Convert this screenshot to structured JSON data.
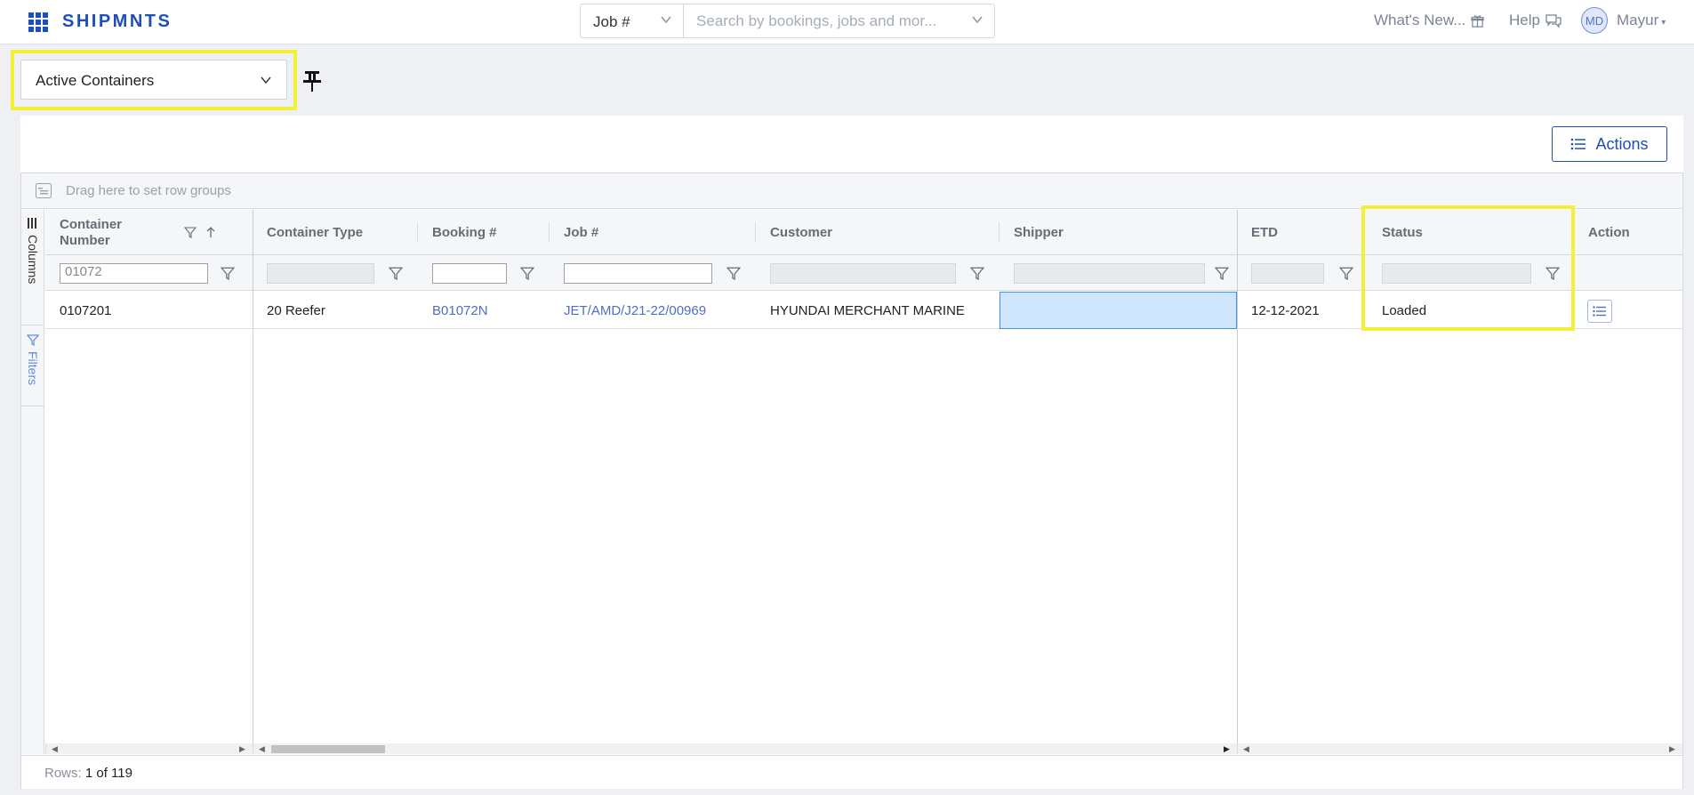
{
  "app": {
    "logo": "SHIPMNTS",
    "search_type": "Job #",
    "search_placeholder": "Search by bookings, jobs and mor...",
    "whats_new": "What's New...",
    "help": "Help",
    "user_initials": "MD",
    "user_name": "Mayur"
  },
  "view": {
    "selected": "Active Containers"
  },
  "toolbar": {
    "actions_label": "Actions"
  },
  "grid": {
    "group_bar_text": "Drag here to set row groups",
    "side_tabs": {
      "columns": "Columns",
      "filters": "Filters"
    },
    "headers": {
      "container_number_line1": "Container",
      "container_number_line2": "Number",
      "container_type": "Container Type",
      "booking": "Booking #",
      "job": "Job #",
      "customer": "Customer",
      "shipper": "Shipper",
      "etd": "ETD",
      "status": "Status",
      "action": "Action"
    },
    "filters": {
      "container_number": "01072"
    },
    "rows": [
      {
        "container_number": "0107201",
        "container_type": "20 Reefer",
        "booking": "B01072N",
        "job": "JET/AMD/J21-22/00969",
        "customer": "HYUNDAI MERCHANT MARINE",
        "shipper": "",
        "etd": "12-12-2021",
        "status": "Loaded"
      }
    ],
    "footer": {
      "rows_label": "Rows:",
      "rows_value": "1 of 119"
    }
  },
  "icons": {
    "apps": "grid-apps-icon",
    "pin": "pin-icon",
    "list": "list-icon",
    "filter": "filter-icon",
    "sort_asc": "arrow-up-icon",
    "gift": "gift-icon",
    "chat": "chat-icon"
  },
  "colors": {
    "brand": "#1d4fb6",
    "highlight": "#f1f13a",
    "link": "#4d6fc4",
    "selected_cell": "#cfe5fb"
  }
}
